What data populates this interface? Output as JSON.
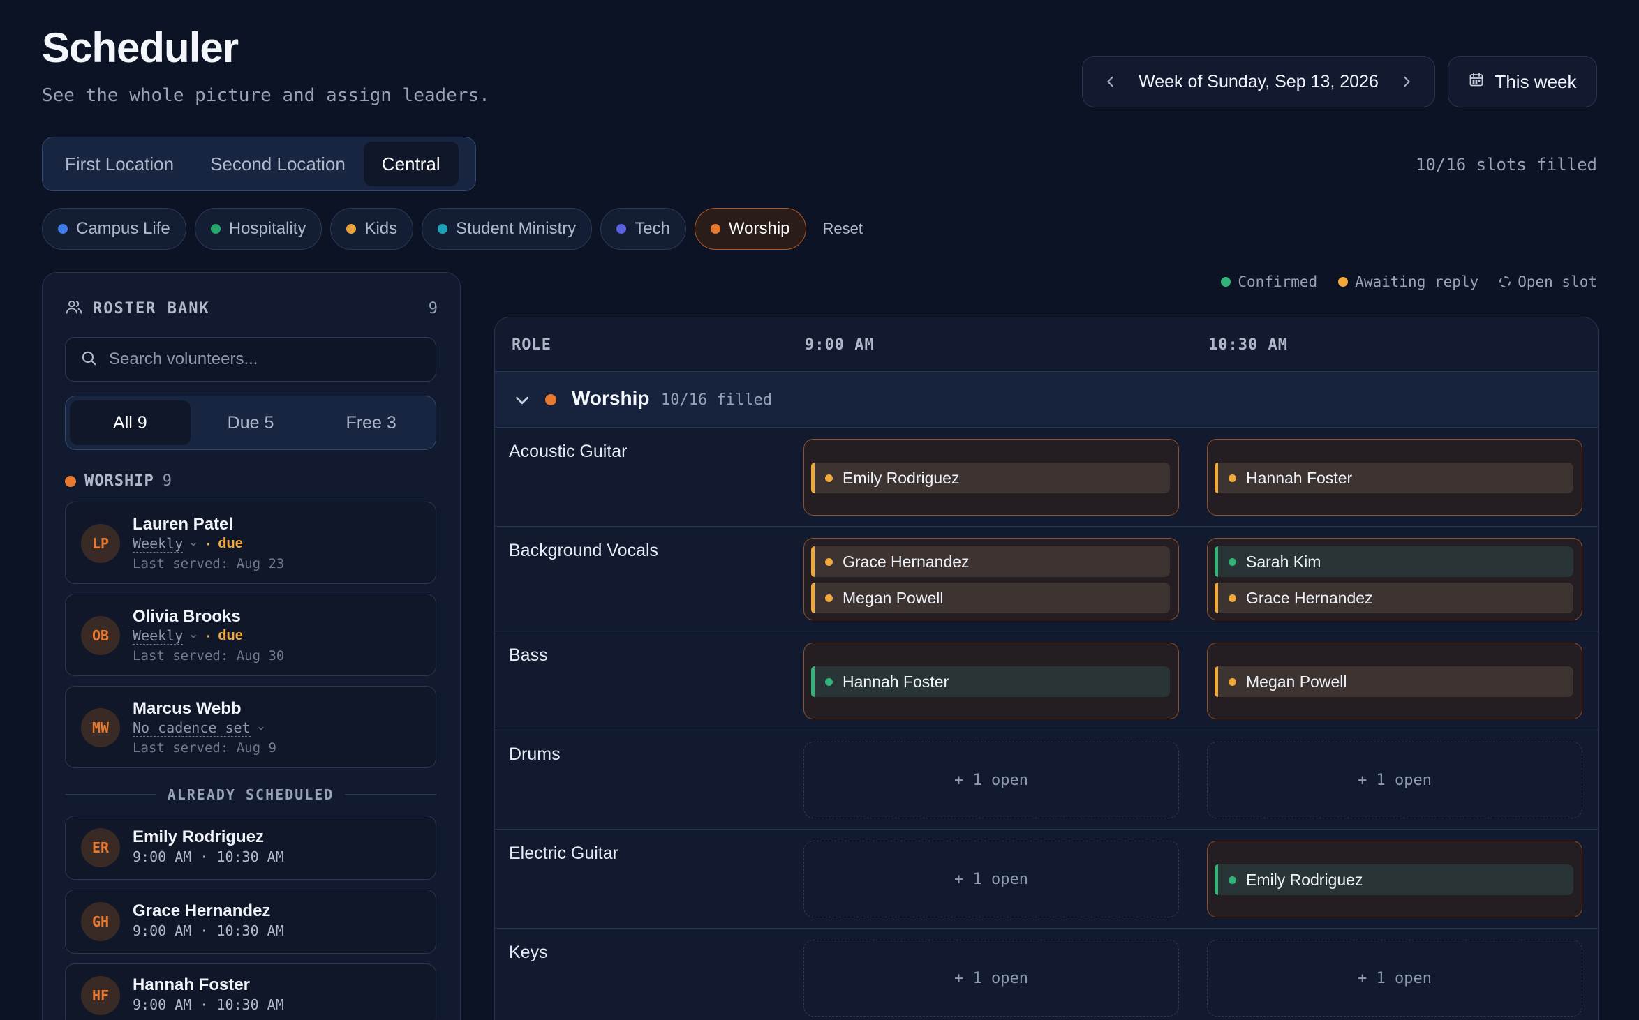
{
  "header": {
    "title": "Scheduler",
    "subtitle": "See the whole picture and assign leaders.",
    "week_label": "Week of Sunday, Sep 13, 2026",
    "this_week_label": "This week"
  },
  "locations": {
    "tabs": [
      {
        "label": "First Location",
        "active": false
      },
      {
        "label": "Second Location",
        "active": false
      },
      {
        "label": "Central",
        "active": true
      }
    ],
    "slots_summary": "10/16 slots filled"
  },
  "filters": {
    "chips": [
      {
        "label": "Campus Life",
        "color": "#3f7be8",
        "active": false
      },
      {
        "label": "Hospitality",
        "color": "#27a86b",
        "active": false
      },
      {
        "label": "Kids",
        "color": "#e9a23b",
        "active": false
      },
      {
        "label": "Student Ministry",
        "color": "#1fa3b8",
        "active": false
      },
      {
        "label": "Tech",
        "color": "#5a62e0",
        "active": false
      },
      {
        "label": "Worship",
        "color": "#e8792e",
        "active": true
      }
    ],
    "reset_label": "Reset"
  },
  "roster": {
    "title": "ROSTER BANK",
    "count": "9",
    "search_placeholder": "Search volunteers...",
    "segments": [
      {
        "label": "All 9",
        "active": true
      },
      {
        "label": "Due 5",
        "active": false
      },
      {
        "label": "Free 3",
        "active": false
      }
    ],
    "group_label": "WORSHIP",
    "group_count": "9",
    "due_people": [
      {
        "initials": "LP",
        "name": "Lauren Patel",
        "cadence": "Weekly",
        "due": "due",
        "last_served": "Last served: Aug 23"
      },
      {
        "initials": "OB",
        "name": "Olivia Brooks",
        "cadence": "Weekly",
        "due": "due",
        "last_served": "Last served: Aug 30"
      },
      {
        "initials": "MW",
        "name": "Marcus Webb",
        "cadence": "No cadence set",
        "due": "",
        "last_served": "Last served: Aug 9"
      }
    ],
    "already_label": "ALREADY SCHEDULED",
    "scheduled_people": [
      {
        "initials": "ER",
        "name": "Emily Rodriguez",
        "times": "9:00 AM · 10:30 AM"
      },
      {
        "initials": "GH",
        "name": "Grace Hernandez",
        "times": "9:00 AM · 10:30 AM"
      },
      {
        "initials": "HF",
        "name": "Hannah Foster",
        "times": "9:00 AM · 10:30 AM"
      }
    ]
  },
  "legend": {
    "confirmed": "Confirmed",
    "awaiting": "Awaiting reply",
    "open": "Open slot",
    "confirmed_color": "#31b37a",
    "awaiting_color": "#f0a93a"
  },
  "grid": {
    "role_header": "ROLE",
    "times": [
      "9:00 AM",
      "10:30 AM"
    ],
    "group_name": "Worship",
    "group_filled": "10/16 filled",
    "open_label": "+ 1 open",
    "roles": [
      {
        "name": "Acoustic Guitar",
        "slots": [
          [
            {
              "name": "Emily Rodriguez",
              "status": "await"
            }
          ],
          [
            {
              "name": "Hannah Foster",
              "status": "await"
            }
          ]
        ]
      },
      {
        "name": "Background Vocals",
        "slots": [
          [
            {
              "name": "Grace Hernandez",
              "status": "await"
            },
            {
              "name": "Megan Powell",
              "status": "await"
            }
          ],
          [
            {
              "name": "Sarah Kim",
              "status": "conf"
            },
            {
              "name": "Grace Hernandez",
              "status": "await"
            }
          ]
        ]
      },
      {
        "name": "Bass",
        "slots": [
          [
            {
              "name": "Hannah Foster",
              "status": "conf"
            }
          ],
          [
            {
              "name": "Megan Powell",
              "status": "await"
            }
          ]
        ]
      },
      {
        "name": "Drums",
        "slots": [
          [],
          []
        ]
      },
      {
        "name": "Electric Guitar",
        "slots": [
          [],
          [
            {
              "name": "Emily Rodriguez",
              "status": "conf"
            }
          ]
        ]
      },
      {
        "name": "Keys",
        "slots": [
          [],
          []
        ]
      }
    ]
  }
}
